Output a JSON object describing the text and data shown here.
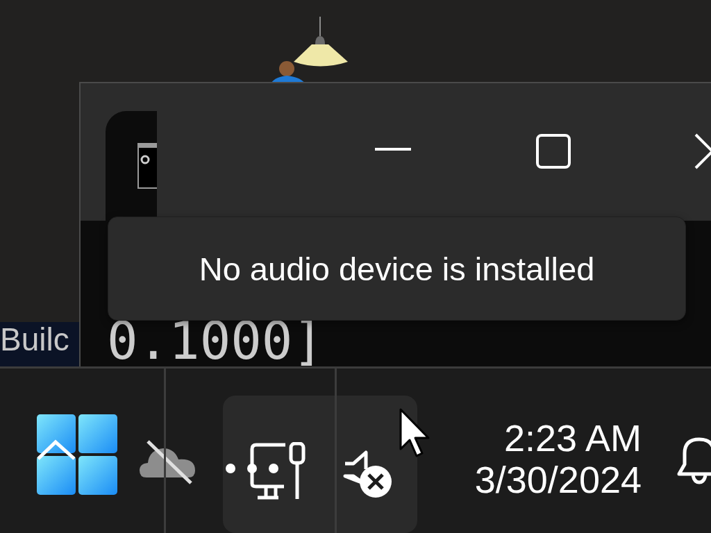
{
  "background_window": {
    "text": "Builc"
  },
  "terminal": {
    "text": "0.1000]"
  },
  "tooltip": {
    "text": "No audio device is installed"
  },
  "clock": {
    "time": "2:23 AM",
    "date": "3/30/2024"
  }
}
